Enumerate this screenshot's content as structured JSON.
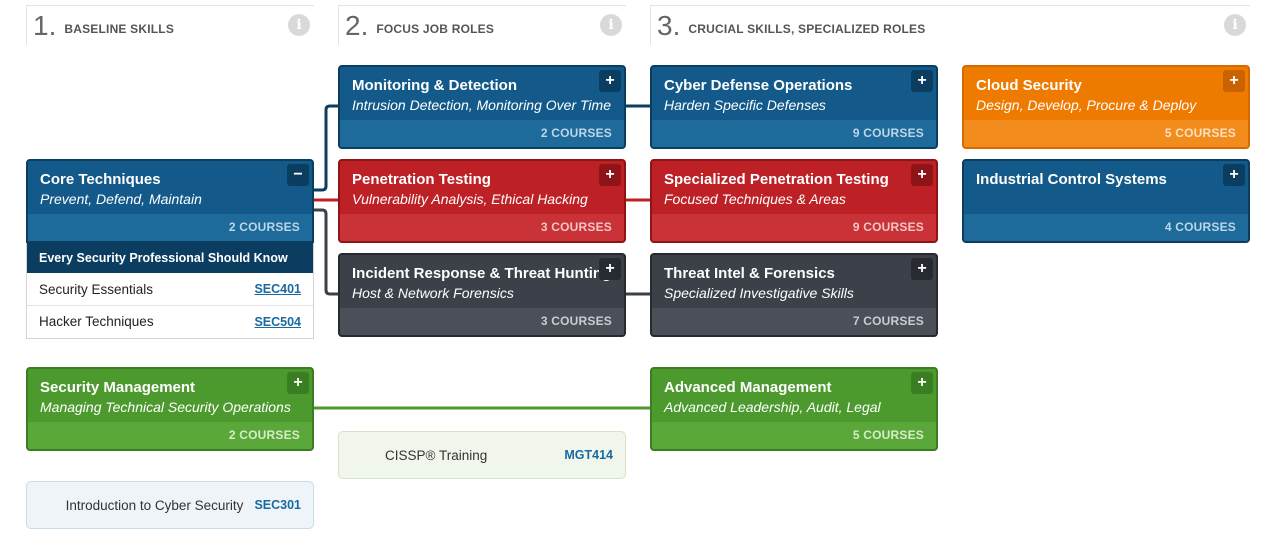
{
  "columns": [
    {
      "number": "1.",
      "title": "BASELINE SKILLS"
    },
    {
      "number": "2.",
      "title": "FOCUS JOB ROLES"
    },
    {
      "number": "3.",
      "title": "CRUCIAL SKILLS, SPECIALIZED ROLES"
    }
  ],
  "info_glyph": "i",
  "expand_glyph": "+",
  "collapse_glyph": "−",
  "cards": {
    "core": {
      "title": "Core Techniques",
      "subtitle": "Prevent, Defend, Maintain",
      "courses": "2 COURSES"
    },
    "monitoring": {
      "title": "Monitoring & Detection",
      "subtitle": "Intrusion Detection, Monitoring Over Time",
      "courses": "2 COURSES"
    },
    "pentest": {
      "title": "Penetration Testing",
      "subtitle": "Vulnerability Analysis, Ethical Hacking",
      "courses": "3 COURSES"
    },
    "incident": {
      "title": "Incident Response & Threat Hunting",
      "subtitle": "Host & Network Forensics",
      "courses": "3 COURSES"
    },
    "cyberdef": {
      "title": "Cyber Defense Operations",
      "subtitle": "Harden Specific Defenses",
      "courses": "9 COURSES"
    },
    "specpen": {
      "title": "Specialized Penetration Testing",
      "subtitle": "Focused Techniques & Areas",
      "courses": "9 COURSES"
    },
    "threatintel": {
      "title": "Threat Intel & Forensics",
      "subtitle": "Specialized Investigative Skills",
      "courses": "7 COURSES"
    },
    "cloud": {
      "title": "Cloud Security",
      "subtitle": "Design, Develop, Procure & Deploy",
      "courses": "5 COURSES"
    },
    "ics": {
      "title": "Industrial Control Systems",
      "courses": "4 COURSES"
    },
    "secmgmt": {
      "title": "Security Management",
      "subtitle": "Managing Technical Security Operations",
      "courses": "2 COURSES"
    },
    "advmgmt": {
      "title": "Advanced Management",
      "subtitle": "Advanced Leadership, Audit, Legal",
      "courses": "5 COURSES"
    }
  },
  "core_expanded": {
    "heading": "Every Security Professional Should Know",
    "courses": [
      {
        "name": "Security Essentials",
        "code": "SEC401"
      },
      {
        "name": "Hacker Techniques",
        "code": "SEC504"
      }
    ]
  },
  "standalone_courses": {
    "cissp": {
      "name": "CISSP® Training",
      "code": "MGT414"
    },
    "intro": {
      "name": "Introduction to Cyber Security",
      "code": "SEC301"
    }
  },
  "colors": {
    "blue": "#135a8a",
    "red": "#bd2025",
    "gray": "#3b4049",
    "green": "#4c9a2e",
    "orange": "#ef7a00",
    "link": "#1a6aa0"
  }
}
